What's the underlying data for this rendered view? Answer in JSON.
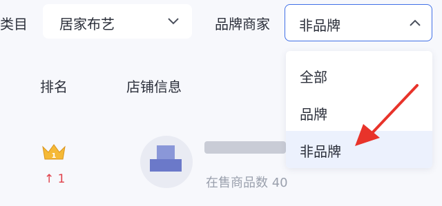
{
  "filters": {
    "category_label": "类目",
    "category_value": "居家布艺",
    "brand_label": "品牌商家",
    "brand_value": "非品牌"
  },
  "dropdown": {
    "options": [
      "全部",
      "品牌",
      "非品牌"
    ],
    "selected": "非品牌"
  },
  "table": {
    "col_rank": "排名",
    "col_store": "店铺信息"
  },
  "row": {
    "rank_change": "↑ 1",
    "store_name": "",
    "items_on_sale": "在售商品数 40"
  },
  "colors": {
    "accent": "#3f6fe6",
    "arrow": "#e8332a",
    "crown": "#f5b936",
    "rank_up": "#e0404a",
    "selected_bg": "#ecf1fd"
  },
  "icons": {
    "crown": "crown-icon",
    "chevron": "chevron-icon",
    "avatar": "avatar"
  }
}
